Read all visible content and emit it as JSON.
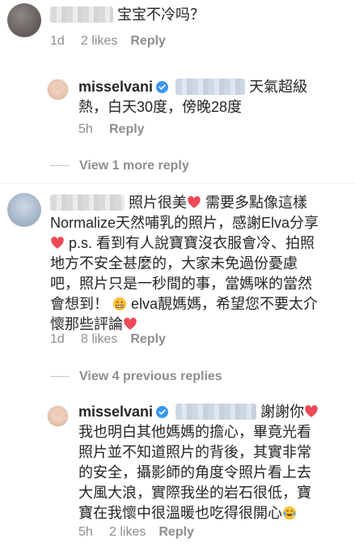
{
  "comments": [
    {
      "text": "宝宝不冷吗？",
      "meta": {
        "time": "1d",
        "likes": "2 likes",
        "reply": "Reply"
      },
      "replies_toggle": "View 1 more reply",
      "reply": {
        "username": "misselvani",
        "lines": [
          "天氣超級",
          "熱，白天30度，傍晚28度"
        ],
        "meta": {
          "time": "5h",
          "reply": "Reply"
        }
      }
    },
    {
      "lines": [
        "照片很美",
        "需要多點像這樣",
        "Normalize天然哺乳的照片，感謝Elva分享",
        "p.s. 看到有人說寶寶沒衣服會冷、拍照",
        "地方不安全甚麼的，大家未免過份憂慮",
        "吧，照片只是一秒間的事，當媽咪的當然",
        "會想到！",
        "elva靚媽媽，希望您不要太介",
        "懷那些評論"
      ],
      "meta": {
        "time": "1d",
        "likes": "8 likes",
        "reply": "Reply"
      },
      "replies_toggle": "View 4 previous replies",
      "reply": {
        "username": "misselvani",
        "lines": [
          "謝謝你",
          "我也明白其他媽媽的擔心，畢竟光看",
          "照片並不知道照片的背後，其實非常",
          "的安全，攝影師的角度令照片看上去",
          "大風大浪，實際我坐的岩石很低，寶",
          "寶在我懷中很溫暖也吃得很開心"
        ],
        "meta": {
          "time": "5h",
          "likes": "2 likes",
          "reply": "Reply"
        }
      }
    }
  ],
  "colors": {
    "verified": "#3897f0",
    "muted": "#8e8e8e",
    "heart": "#ed4956",
    "text": "#262626"
  },
  "icons": [
    "verified-badge-icon",
    "red-heart-icon",
    "grimacing-face-icon",
    "crying-laughing-icon"
  ]
}
